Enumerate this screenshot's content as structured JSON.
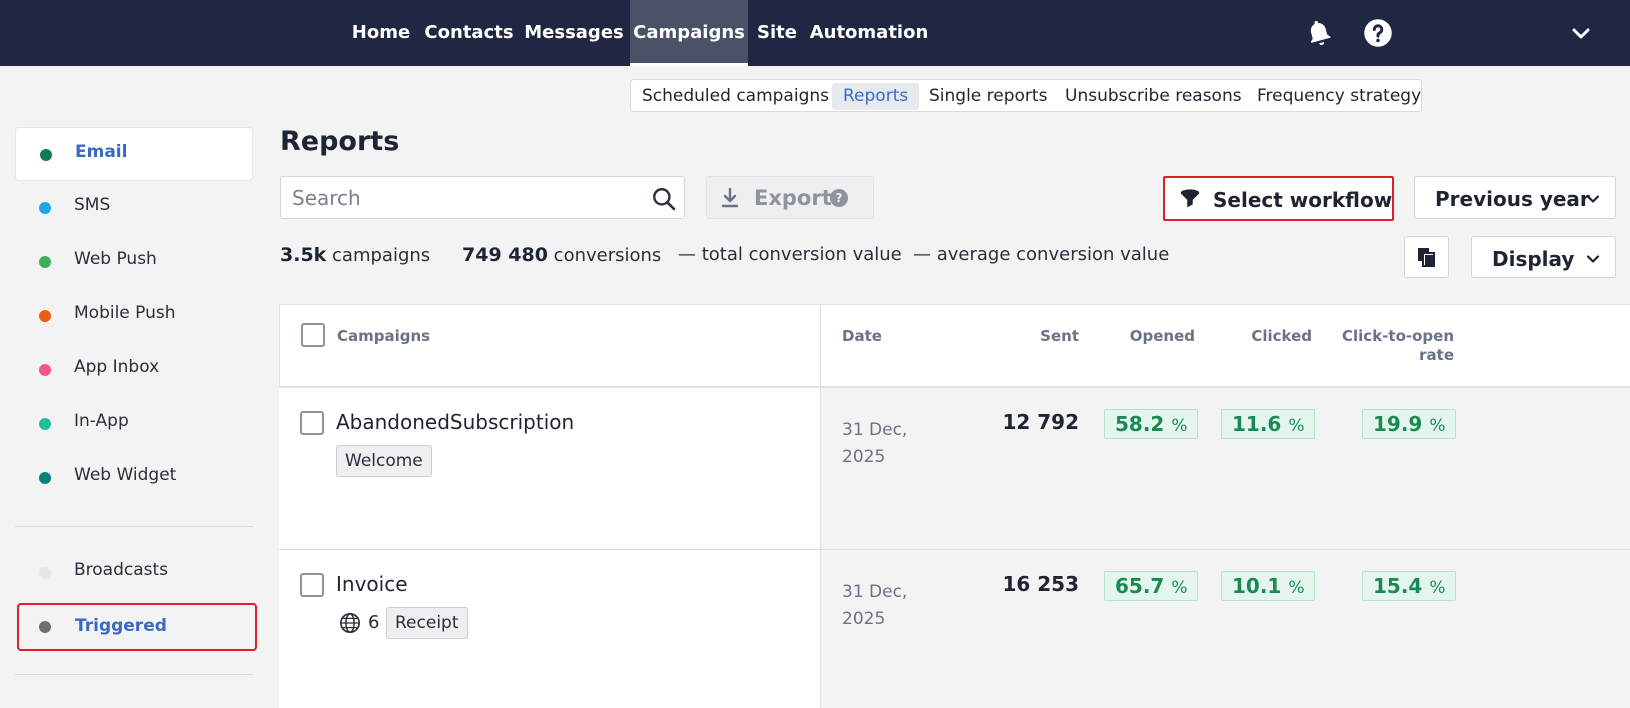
{
  "topnav": {
    "items": [
      "Home",
      "Contacts",
      "Messages",
      "Campaigns",
      "Site",
      "Automation"
    ],
    "active": "Campaigns"
  },
  "subnav": {
    "items": [
      "Scheduled campaigns",
      "Reports",
      "Single reports",
      "Unsubscribe reasons",
      "Frequency strategy"
    ],
    "active": "Reports"
  },
  "sidebar": {
    "channels": [
      {
        "label": "Email",
        "color": "#0f7a55"
      },
      {
        "label": "SMS",
        "color": "#1aa8e8"
      },
      {
        "label": "Web Push",
        "color": "#3fae5a"
      },
      {
        "label": "Mobile Push",
        "color": "#f05a14"
      },
      {
        "label": "App Inbox",
        "color": "#f2588f"
      },
      {
        "label": "In-App",
        "color": "#1fbf9a"
      },
      {
        "label": "Web Widget",
        "color": "#087f7d"
      }
    ],
    "types": [
      {
        "label": "Broadcasts",
        "color": "#e6e7ea"
      },
      {
        "label": "Triggered",
        "color": "#707070"
      }
    ]
  },
  "main": {
    "title": "Reports",
    "search_placeholder": "Search",
    "export_label": "Export",
    "help_glyph": "?",
    "workflow_label": "Select workflow",
    "period_label": "Previous year",
    "display_label": "Display"
  },
  "stats": {
    "campaigns_value": "3.5k",
    "campaigns_label": "campaigns",
    "conversions_value": "749 480",
    "conversions_label": "conversions",
    "total_value_dash": "—",
    "total_value_label": "total conversion value",
    "avg_value_dash": "—",
    "avg_value_label": "average conversion value"
  },
  "table": {
    "headers": {
      "campaigns": "Campaigns",
      "date": "Date",
      "sent": "Sent",
      "opened": "Opened",
      "clicked": "Clicked",
      "cto_line1": "Click-to-open",
      "cto_line2": "rate"
    },
    "rows": [
      {
        "name": "AbandonedSubscription",
        "tag": "Welcome",
        "count": "",
        "date_line1": "31 Dec,",
        "date_line2": "2025",
        "sent": "12 792",
        "opened": "58.2",
        "clicked": "11.6",
        "cto": "19.9"
      },
      {
        "name": "Invoice",
        "tag": "Receipt",
        "count": "6",
        "date_line1": "31 Dec,",
        "date_line2": "2025",
        "sent": "16 253",
        "opened": "65.7",
        "clicked": "10.1",
        "cto": "15.4"
      }
    ],
    "percent_unit": "%"
  }
}
